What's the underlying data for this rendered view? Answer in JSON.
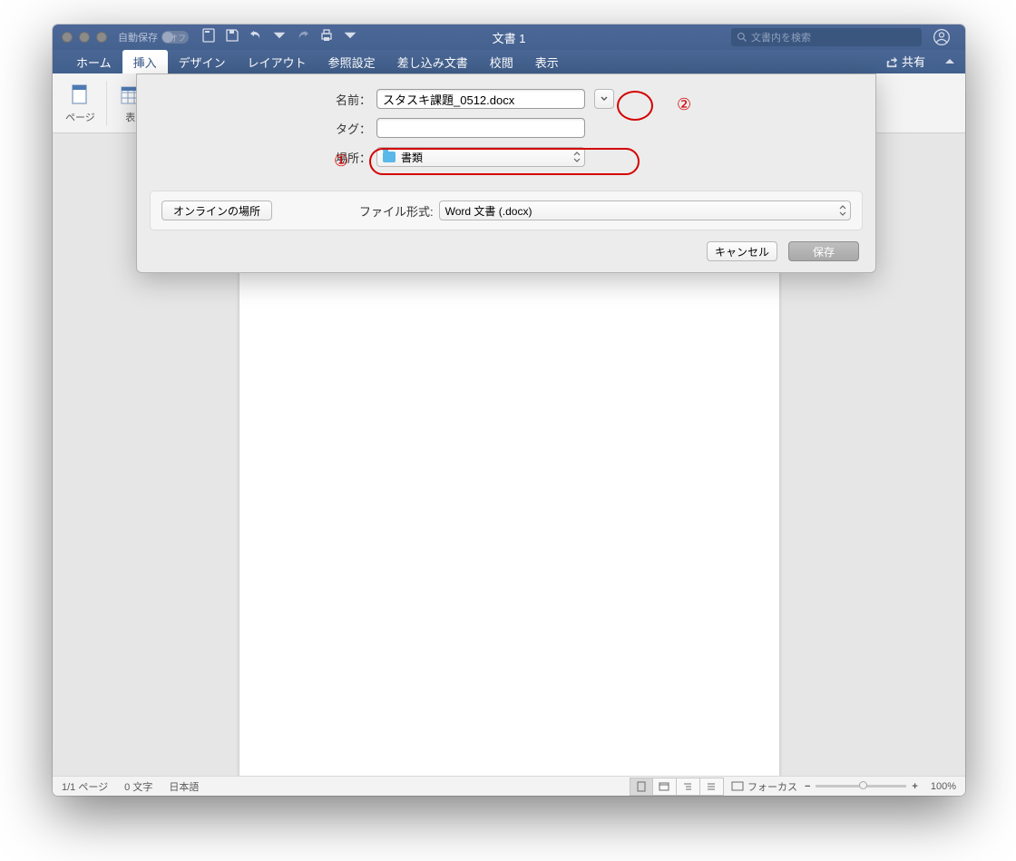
{
  "titlebar": {
    "doc_title": "文書 1",
    "autosave_label": "自動保存",
    "autosave_state": "オフ",
    "search_placeholder": "文書内を検索"
  },
  "ribbon_tabs": [
    "ホーム",
    "挿入",
    "デザイン",
    "レイアウト",
    "参照設定",
    "差し込み文書",
    "校閲",
    "表示"
  ],
  "ribbon_active_index": 1,
  "share_label": "共有",
  "ribbon_groups": {
    "pages": "ページ",
    "table": "表"
  },
  "dialog": {
    "name_label": "名前：",
    "name_value": "スタスキ課題_0512.docx",
    "tag_label": "タグ：",
    "tag_value": "",
    "location_label": "場所：",
    "location_value": "書類",
    "online_btn": "オンラインの場所",
    "fileformat_label": "ファイル形式:",
    "fileformat_value": "Word 文書 (.docx)",
    "cancel": "キャンセル",
    "save": "保存"
  },
  "annotations": {
    "one": "①",
    "two": "②"
  },
  "statusbar": {
    "page": "1/1 ページ",
    "words": "0 文字",
    "lang": "日本語",
    "focus": "フォーカス",
    "zoom": "100%"
  }
}
